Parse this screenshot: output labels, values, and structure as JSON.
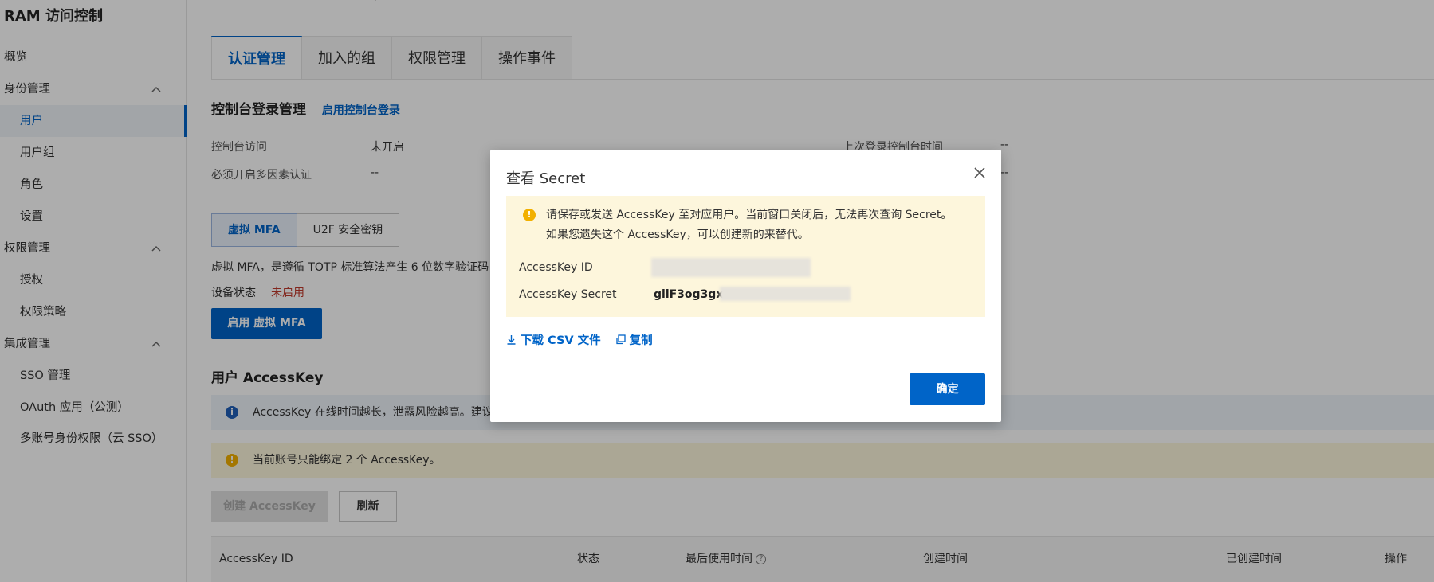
{
  "sidebar": {
    "title": "RAM 访问控制",
    "items": [
      {
        "label": "概览",
        "level": "top"
      },
      {
        "label": "身份管理",
        "level": "top",
        "expandable": true
      },
      {
        "label": "用户",
        "level": "sub",
        "active": true
      },
      {
        "label": "用户组",
        "level": "sub"
      },
      {
        "label": "角色",
        "level": "sub"
      },
      {
        "label": "设置",
        "level": "sub"
      },
      {
        "label": "权限管理",
        "level": "top",
        "expandable": true
      },
      {
        "label": "授权",
        "level": "sub"
      },
      {
        "label": "权限策略",
        "level": "sub"
      },
      {
        "label": "集成管理",
        "level": "top",
        "expandable": true
      },
      {
        "label": "SSO 管理",
        "level": "sub"
      },
      {
        "label": "OAuth 应用（公测）",
        "level": "sub"
      },
      {
        "label": "多账号身份权限（云 SSO）",
        "level": "sub"
      }
    ]
  },
  "main": {
    "tabs": [
      "认证管理",
      "加入的组",
      "权限管理",
      "操作事件"
    ],
    "console": {
      "title": "控制台登录管理",
      "enable_link": "启用控制台登录",
      "access_label": "控制台访问",
      "access_value": "未开启",
      "mfa_required_label": "必须开启多因素认证",
      "mfa_required_value": "--",
      "last_login_label": "上次登录控制台时间",
      "last_login_value": "--",
      "extra_value": "--"
    },
    "mfa": {
      "seg_virtual": "虚拟 MFA",
      "seg_u2f": "U2F 安全密钥",
      "desc": "虚拟 MFA，是遵循 TOTP 标准算法产生 6 位数字验证码",
      "status_label": "设备状态",
      "status_value": "未启用",
      "enable_button": "启用 虚拟 MFA"
    },
    "accesskey": {
      "title": "用户 AccessKey",
      "info_banner": "AccessKey 在线时间越长，泄露风险越高。建议",
      "warn_banner": "当前账号只能绑定 2 个 AccessKey。",
      "create_button": "创建 AccessKey",
      "refresh_button": "刷新",
      "columns": [
        "AccessKey ID",
        "状态",
        "最后使用时间",
        "创建时间",
        "已创建时间",
        "操作"
      ]
    }
  },
  "modal": {
    "title": "查看 Secret",
    "notice": "请保存或发送 AccessKey 至对应用户。当前窗口关闭后，无法再次查询 Secret。如果您遗失这个 AccessKey，可以创建新的来替代。",
    "id_label": "AccessKey ID",
    "secret_label": "AccessKey Secret",
    "secret_value_visible": "gliF3og3gx",
    "download_label": "下载 CSV 文件",
    "copy_label": "复制",
    "confirm_label": "确定"
  },
  "colors": {
    "brand": "#0064c8",
    "warning": "#f2b000",
    "danger": "#c0392b"
  }
}
